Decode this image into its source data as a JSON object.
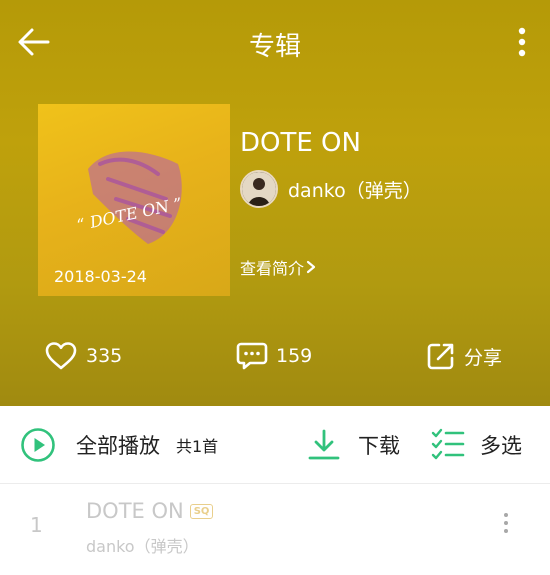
{
  "topbar": {
    "title": "专辑",
    "back_icon": "arrow-left-icon",
    "more_icon": "more-vertical-icon"
  },
  "album": {
    "cover_text": "“ DOTE ON ”",
    "release_date": "2018-03-24",
    "name": "DOTE ON",
    "artist": "danko（弹壳）",
    "intro_link": "查看简介"
  },
  "stats": {
    "likes": "335",
    "comments": "159",
    "share_label": "分享"
  },
  "toolbar": {
    "play_all_label": "全部播放",
    "song_count": "共1首",
    "download_label": "下载",
    "multi_select_label": "多选"
  },
  "songs": [
    {
      "index": "1",
      "title": "DOTE ON",
      "quality_badge": "SQ",
      "artist": "danko（弹壳）"
    }
  ],
  "colors": {
    "header_bg": "#b59a08",
    "accent_green": "#31c27c",
    "sq_badge": "#e9cf8c",
    "inactive_text": "#c8c8c8"
  }
}
